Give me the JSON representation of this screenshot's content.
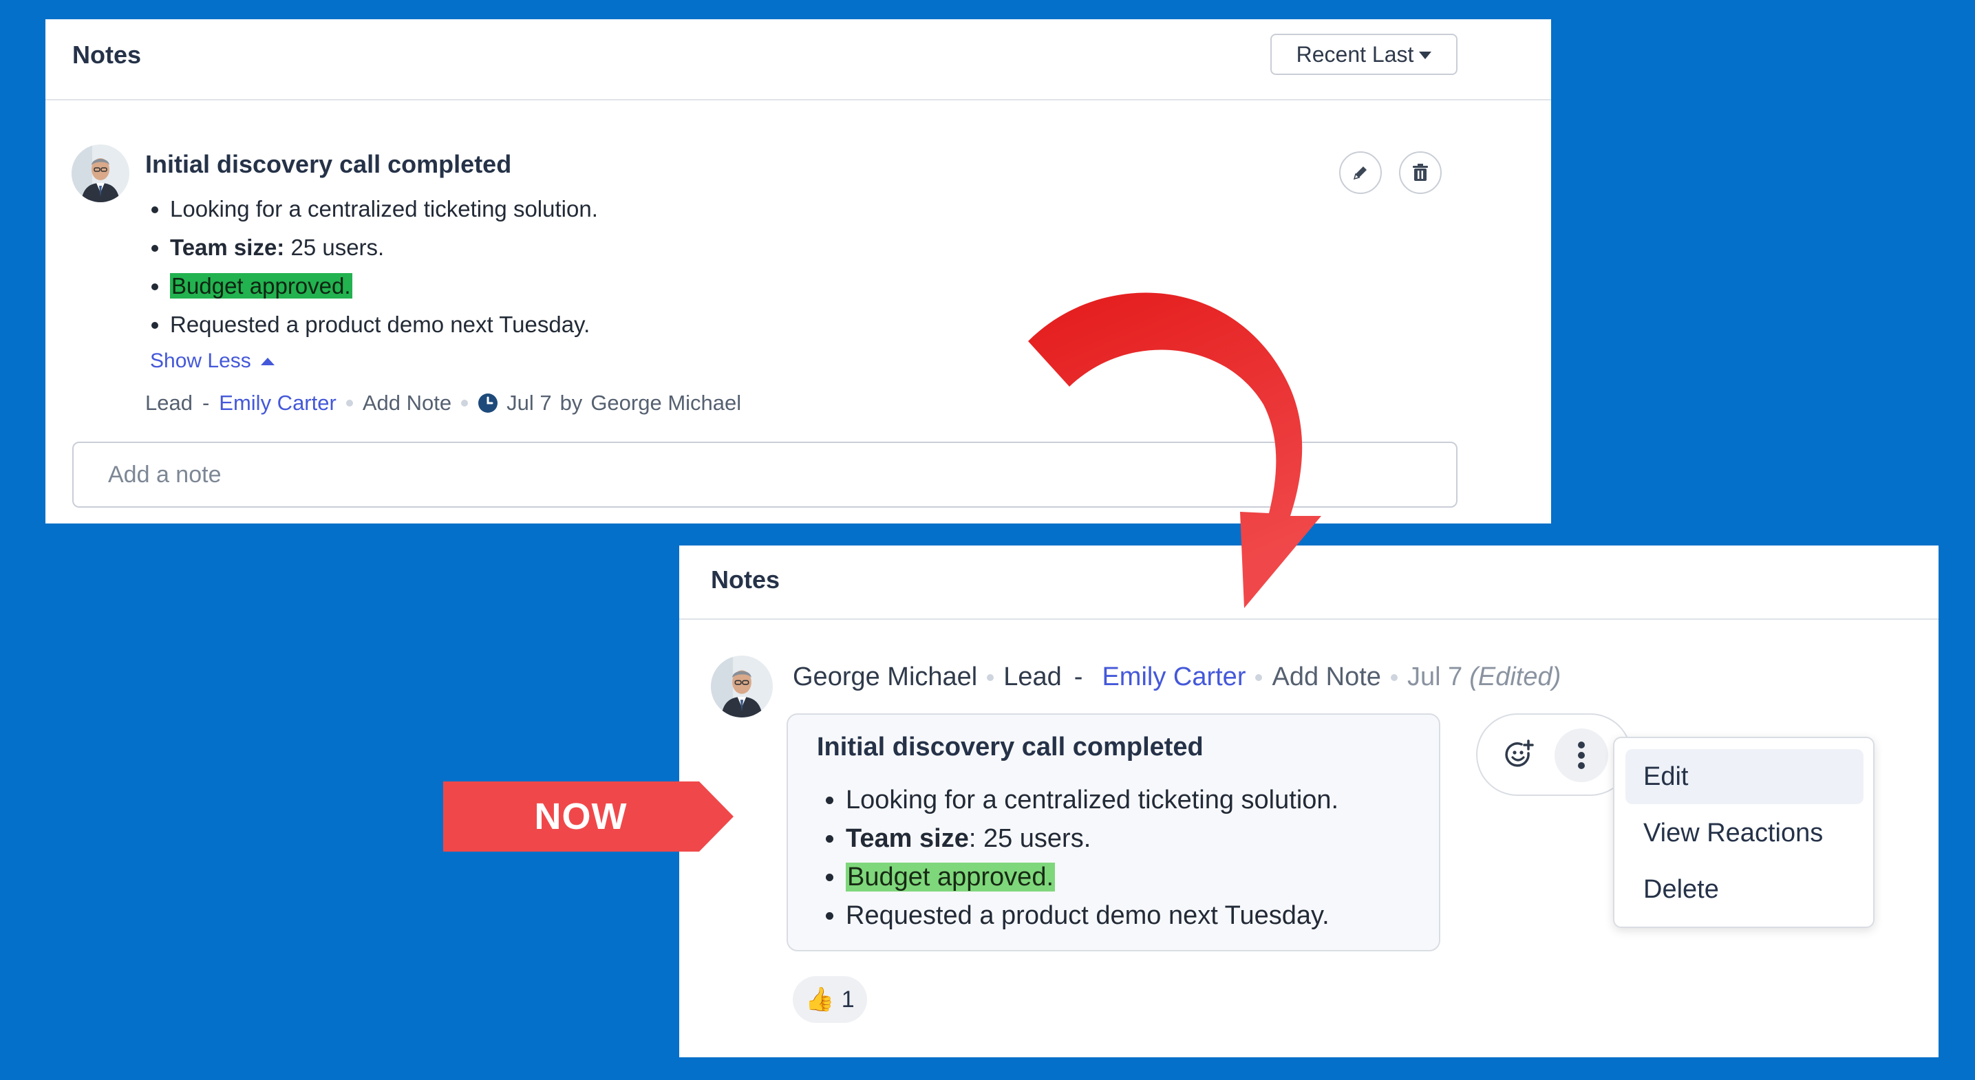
{
  "colors": {
    "background": "#0470c9",
    "link": "#4458d9",
    "highlight_old": "#22b24f",
    "highlight_new": "#7fd77b",
    "arrow_red": "#f0484a"
  },
  "old_panel": {
    "title": "Notes",
    "sort_label": "Recent Last",
    "note": {
      "title": "Initial discovery call completed",
      "bullets": [
        {
          "text": "Looking for a centralized ticketing solution."
        },
        {
          "bold": "Team size:",
          "text": " 25 users."
        },
        {
          "highlight": "Budget approved."
        },
        {
          "text": "Requested a product demo next Tuesday."
        }
      ],
      "show_less": "Show Less",
      "meta": {
        "type": "Lead",
        "separator": "-",
        "contact": "Emily Carter",
        "action": "Add Note",
        "date": "Jul 7",
        "by": "by",
        "author": "George Michael"
      }
    },
    "edit_icon": "pencil-icon",
    "delete_icon": "trash-icon",
    "add_note_placeholder": "Add a note"
  },
  "callout": {
    "label": "NOW"
  },
  "new_panel": {
    "title": "Notes",
    "header_meta": {
      "author": "George Michael",
      "type": "Lead",
      "separator": "-",
      "contact": "Emily Carter",
      "action": "Add Note",
      "date": "Jul 7",
      "edited": "(Edited)"
    },
    "note": {
      "title": "Initial discovery call completed",
      "bullets": [
        {
          "text": "Looking for a centralized ticketing solution."
        },
        {
          "bold": "Team size",
          "text": ": 25 users."
        },
        {
          "highlight": "Budget approved."
        },
        {
          "text": "Requested a product demo next Tuesday."
        }
      ]
    },
    "reaction": {
      "emoji": "👍",
      "count": "1"
    },
    "menu": {
      "items": [
        "Edit",
        "View Reactions",
        "Delete"
      ],
      "active": "Edit"
    }
  }
}
